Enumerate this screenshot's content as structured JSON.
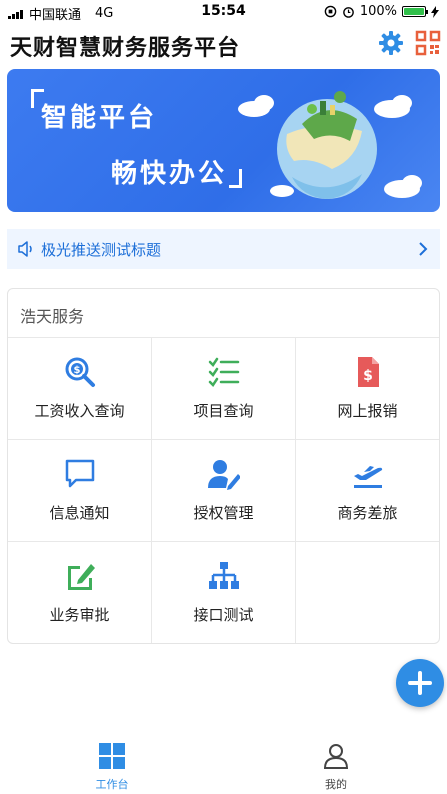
{
  "status_bar": {
    "carrier": "中国联通",
    "network": "4G",
    "time": "15:54",
    "battery": "100%"
  },
  "header": {
    "title": "天财智慧财务服务平台"
  },
  "banner": {
    "line1": "智能平台",
    "line2": "畅快办公"
  },
  "notice": {
    "text": "极光推送测试标题"
  },
  "services": {
    "title": "浩天服务",
    "items": [
      {
        "label": "工资收入查询",
        "icon": "salary-search-icon",
        "color": "#2f7de1"
      },
      {
        "label": "项目查询",
        "icon": "checklist-icon",
        "color": "#3fae5a"
      },
      {
        "label": "网上报销",
        "icon": "dollar-document-icon",
        "color": "#e65a5a"
      },
      {
        "label": "信息通知",
        "icon": "message-icon",
        "color": "#2f7de1"
      },
      {
        "label": "授权管理",
        "icon": "user-edit-icon",
        "color": "#2f7de1"
      },
      {
        "label": "商务差旅",
        "icon": "plane-icon",
        "color": "#2f7de1"
      },
      {
        "label": "业务审批",
        "icon": "edit-square-icon",
        "color": "#3fae5a"
      },
      {
        "label": "接口测试",
        "icon": "sitemap-icon",
        "color": "#2f7de1"
      }
    ]
  },
  "tabbar": {
    "work": "工作台",
    "mine": "我的"
  },
  "colors": {
    "accent": "#2f8de4",
    "banner": "#3370ea"
  }
}
